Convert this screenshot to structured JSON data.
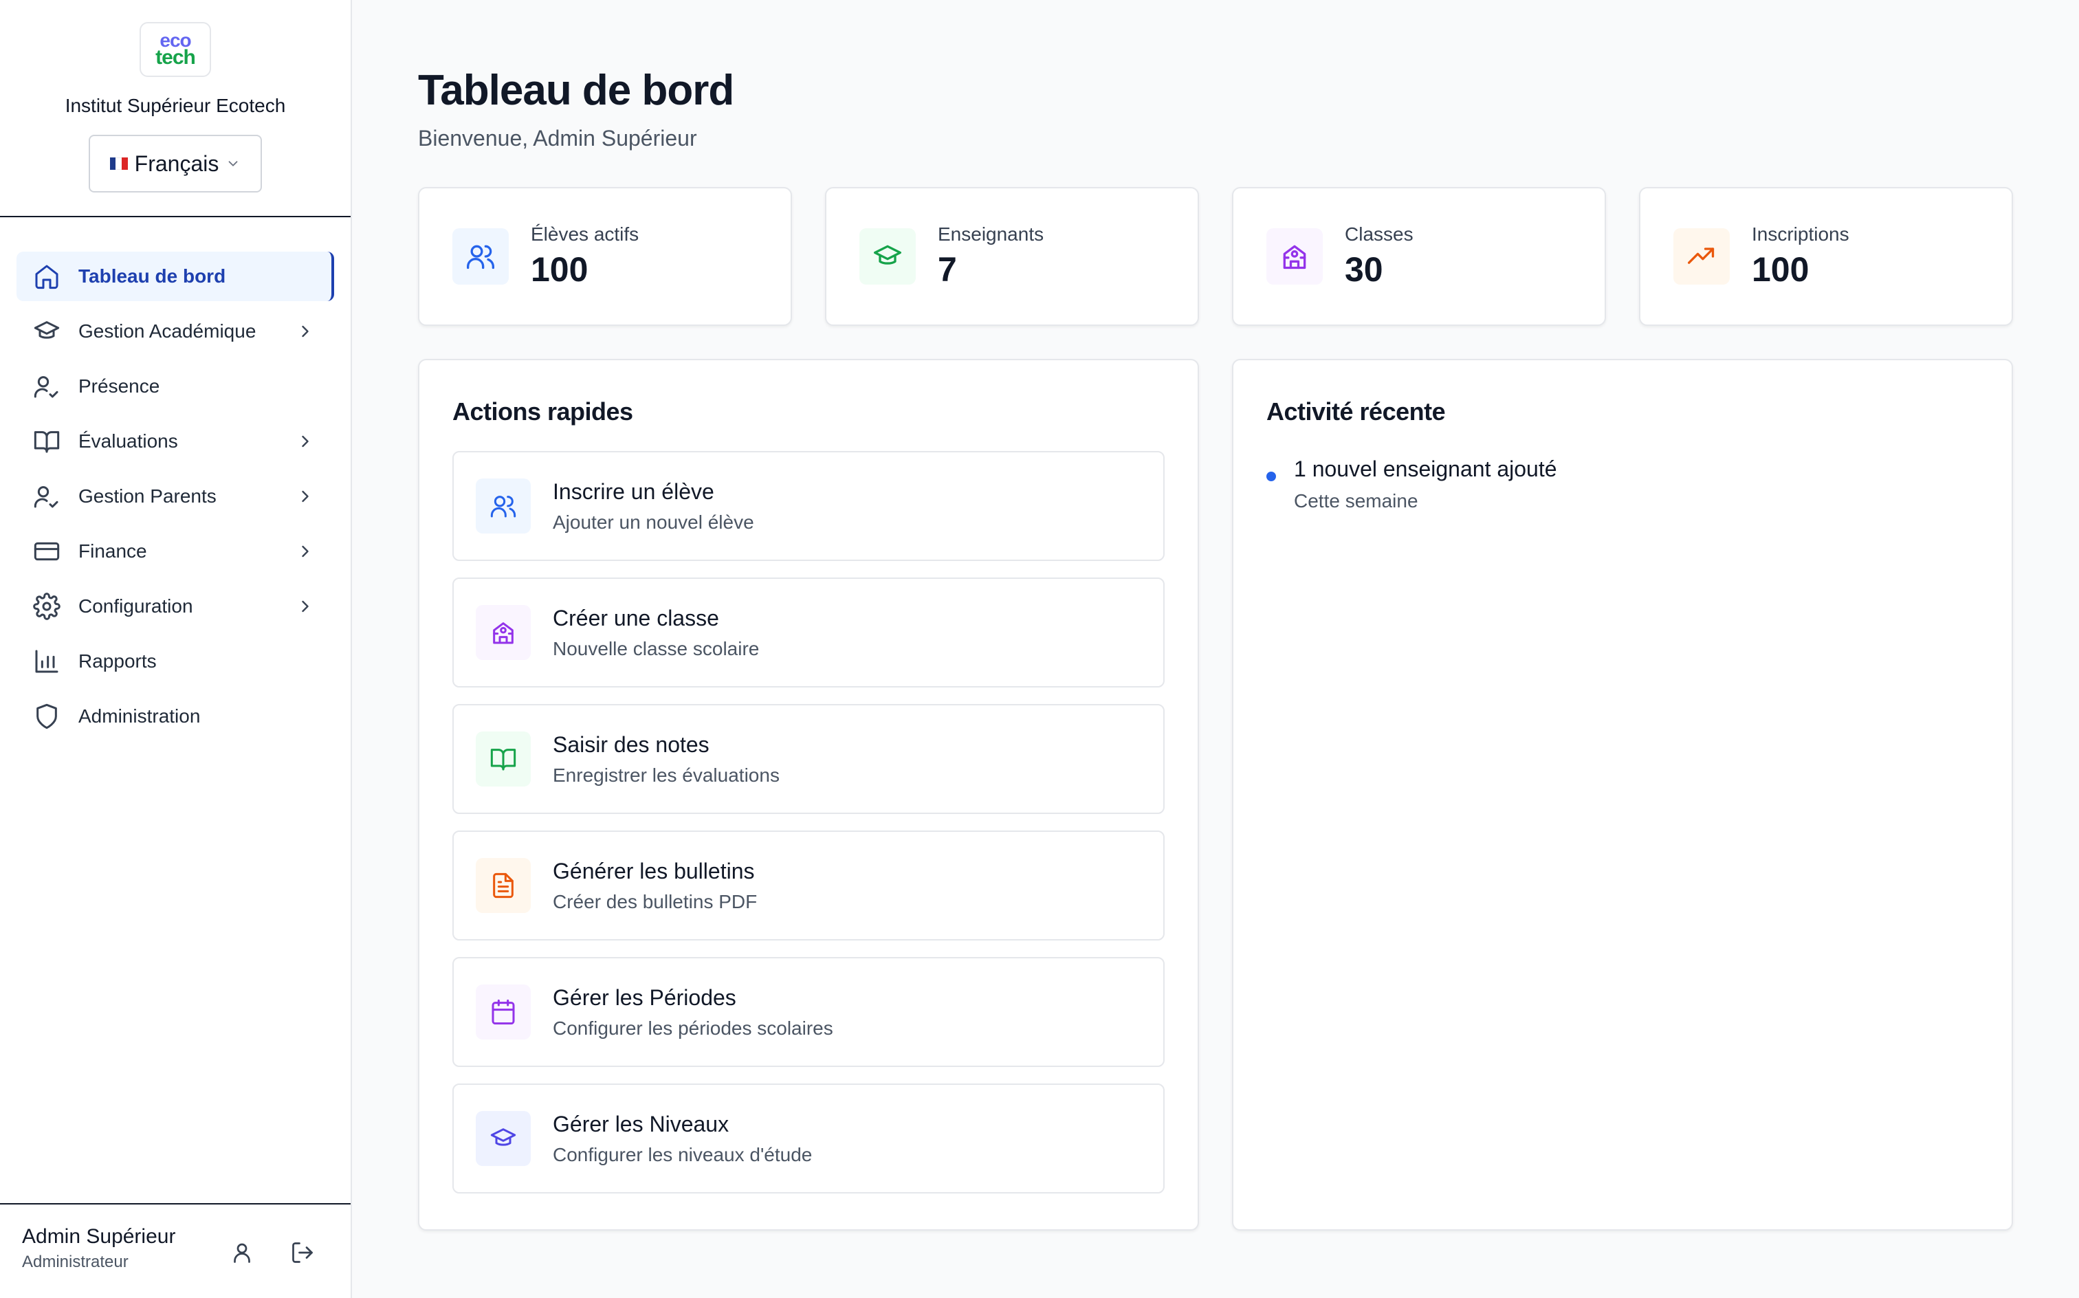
{
  "brand": {
    "logo_top": "eco",
    "logo_bottom": "tech",
    "school_name": "Institut Supérieur Ecotech",
    "language": "Français"
  },
  "sidebar": {
    "items": [
      {
        "label": "Tableau de bord",
        "icon": "home-icon",
        "active": true,
        "has_children": false
      },
      {
        "label": "Gestion Académique",
        "icon": "graduation-cap-icon",
        "active": false,
        "has_children": true
      },
      {
        "label": "Présence",
        "icon": "user-check-icon",
        "active": false,
        "has_children": false
      },
      {
        "label": "Évaluations",
        "icon": "book-open-icon",
        "active": false,
        "has_children": true
      },
      {
        "label": "Gestion Parents",
        "icon": "user-check-icon",
        "active": false,
        "has_children": true
      },
      {
        "label": "Finance",
        "icon": "credit-card-icon",
        "active": false,
        "has_children": true
      },
      {
        "label": "Configuration",
        "icon": "gear-icon",
        "active": false,
        "has_children": true
      },
      {
        "label": "Rapports",
        "icon": "bar-chart-icon",
        "active": false,
        "has_children": false
      },
      {
        "label": "Administration",
        "icon": "shield-icon",
        "active": false,
        "has_children": false
      }
    ]
  },
  "user": {
    "name": "Admin Supérieur",
    "role": "Administrateur"
  },
  "header": {
    "title": "Tableau de bord",
    "subtitle": "Bienvenue, Admin Supérieur"
  },
  "stats": [
    {
      "label": "Élèves actifs",
      "value": "100",
      "icon": "users-icon",
      "color": "#2563eb",
      "bg": "#eff6ff"
    },
    {
      "label": "Enseignants",
      "value": "7",
      "icon": "graduation-cap-icon",
      "color": "#16a34a",
      "bg": "#f0fdf4"
    },
    {
      "label": "Classes",
      "value": "30",
      "icon": "school-icon",
      "color": "#9333ea",
      "bg": "#faf5ff"
    },
    {
      "label": "Inscriptions",
      "value": "100",
      "icon": "trending-up-icon",
      "color": "#ea580c",
      "bg": "#fff7ed"
    }
  ],
  "quick_actions": {
    "title": "Actions rapides",
    "items": [
      {
        "title": "Inscrire un élève",
        "desc": "Ajouter un nouvel élève",
        "icon": "users-icon",
        "color": "#2563eb",
        "bg": "#eff6ff"
      },
      {
        "title": "Créer une classe",
        "desc": "Nouvelle classe scolaire",
        "icon": "school-icon",
        "color": "#9333ea",
        "bg": "#faf5ff"
      },
      {
        "title": "Saisir des notes",
        "desc": "Enregistrer les évaluations",
        "icon": "book-open-icon",
        "color": "#16a34a",
        "bg": "#f0fdf4"
      },
      {
        "title": "Générer les bulletins",
        "desc": "Créer des bulletins PDF",
        "icon": "file-text-icon",
        "color": "#ea580c",
        "bg": "#fff7ed"
      },
      {
        "title": "Gérer les Périodes",
        "desc": "Configurer les périodes scolaires",
        "icon": "calendar-icon",
        "color": "#9333ea",
        "bg": "#faf5ff"
      },
      {
        "title": "Gérer les Niveaux",
        "desc": "Configurer les niveaux d'étude",
        "icon": "graduation-cap-icon",
        "color": "#4f46e5",
        "bg": "#eef2ff"
      }
    ]
  },
  "recent_activity": {
    "title": "Activité récente",
    "items": [
      {
        "title": "1 nouvel enseignant ajouté",
        "time": "Cette semaine"
      }
    ]
  }
}
